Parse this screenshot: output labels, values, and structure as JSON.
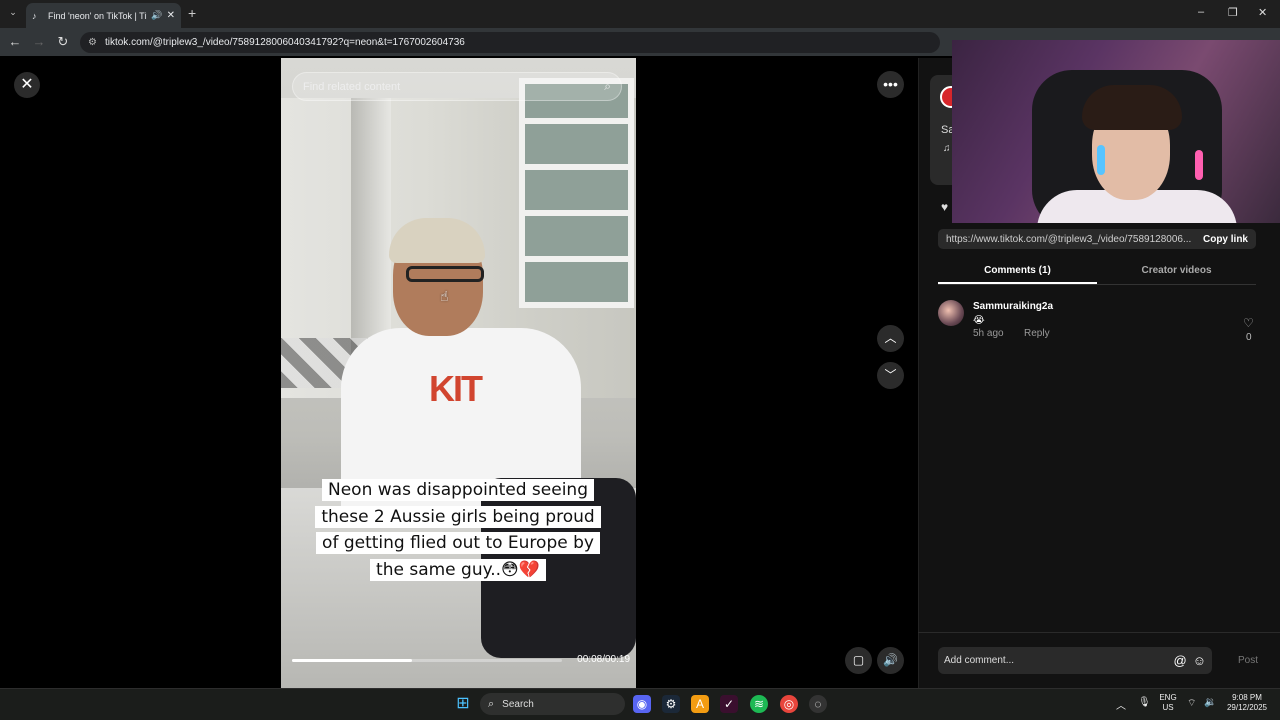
{
  "browser": {
    "tab_title": "Find 'neon' on TikTok | TikTo",
    "url": "tiktok.com/@triplew3_/video/7589128006040341792?q=neon&t=1767002604736"
  },
  "video": {
    "search_placeholder": "Find related content",
    "caption_lines": [
      "Neon was disappointed seeing",
      "these 2 Aussie girls being proud",
      "of getting flied out to Europe by",
      "the same guy..😳💔"
    ],
    "shirt_logo": "KIT",
    "timecode": "00:08/00:19",
    "progress": 0.445
  },
  "panel": {
    "username_partial": "Sa",
    "share_url": "https://www.tiktok.com/@triplew3_/video/7589128006...",
    "copy_link_label": "Copy link",
    "tabs": [
      {
        "label": "Comments (1)",
        "active": true
      },
      {
        "label": "Creator videos",
        "active": false
      }
    ],
    "comments": [
      {
        "user": "Sammuraiking2a",
        "text": "😭",
        "time": "5h ago",
        "reply_label": "Reply",
        "likes": "0"
      }
    ],
    "comment_placeholder": "Add comment...",
    "post_label": "Post"
  },
  "taskbar": {
    "search_label": "Search",
    "lang_line1": "ENG",
    "lang_line2": "US",
    "time": "9:08 PM",
    "date": "29/12/2025"
  },
  "colors": {
    "accent_red": "#d7262b",
    "panel_bg": "#121212"
  }
}
